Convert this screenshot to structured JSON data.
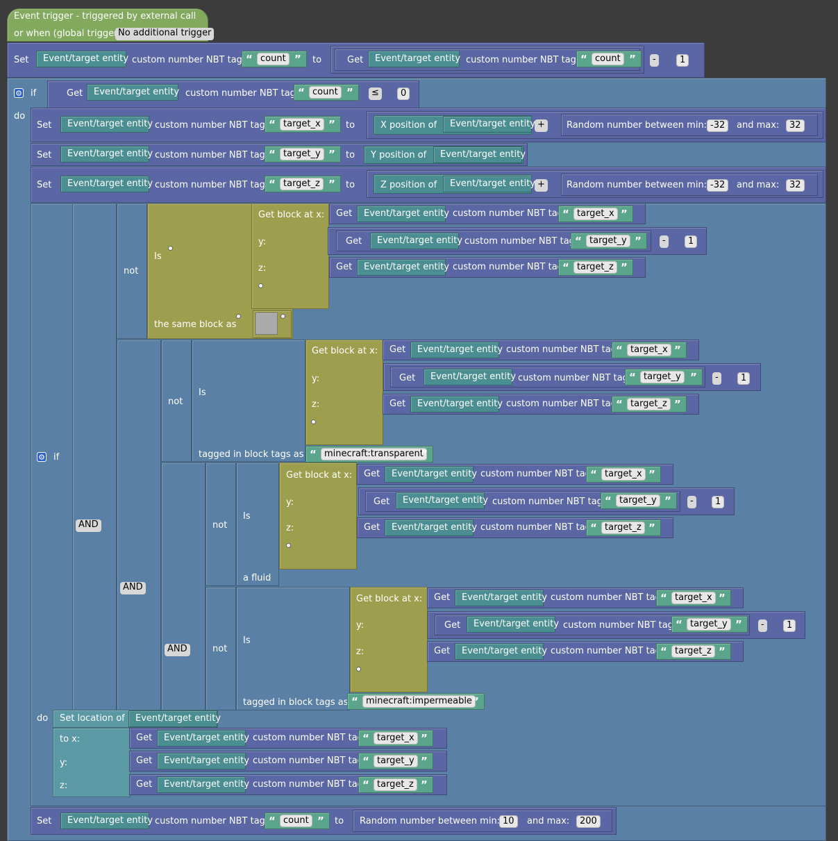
{
  "colors": {
    "background": "#3c3c3c",
    "event": "#83a95f",
    "action": "#5b67a5",
    "control": "#5b80a5",
    "entity": "#4a8e91",
    "text": "#5ba58c",
    "block": "#9e9e4f",
    "location": "#5b99a5"
  },
  "trigger": {
    "line1": "Event trigger - triggered by external call",
    "line2": "or when (global trigger):",
    "value": "No additional trigger"
  },
  "w": {
    "set": "Set",
    "get": "Get",
    "entity": "Event/target entity",
    "nbt": "custom number NBT tag",
    "to": "to",
    "if": "if",
    "do": "do",
    "xpos": "X position of",
    "ypos": "Y position of",
    "zpos": "Z position of",
    "rand_min": "Random number between min:",
    "and_max": "and max:",
    "plus": "+",
    "minus": "-",
    "le": "≤",
    "not": "not",
    "is": "Is",
    "same": "the same block as",
    "getblock": "Get block at x:",
    "y": "y:",
    "z": "z:",
    "tagged": "tagged in block tags as",
    "fluid": "a fluid",
    "and": "AND",
    "setloc": "Set location of",
    "tox": "to x:"
  },
  "tags": {
    "count": "count",
    "tx": "target_x",
    "ty": "target_y",
    "tz": "target_z"
  },
  "nums": {
    "one": "1",
    "zero": "0",
    "m32": "-32",
    "p32": "32",
    "ten": "10",
    "two_hundred": "200"
  },
  "btags": {
    "transparent": "minecraft:transparent",
    "impermeable": "minecraft:impermeable"
  }
}
